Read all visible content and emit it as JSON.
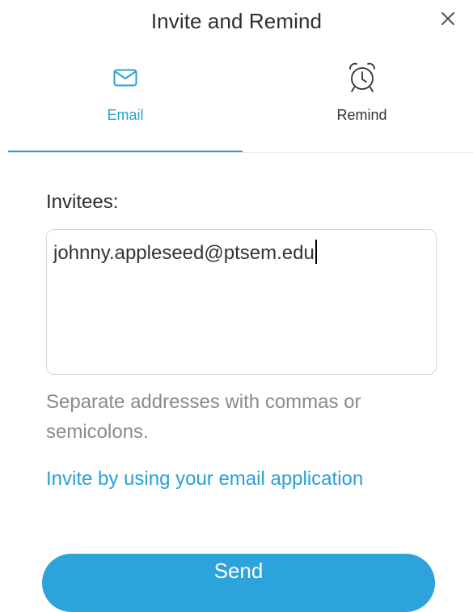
{
  "header": {
    "title": "Invite and Remind",
    "close_icon": "close-icon"
  },
  "tabs": [
    {
      "label": "Email",
      "icon": "envelope-icon",
      "active": true
    },
    {
      "label": "Remind",
      "icon": "alarm-clock-icon",
      "active": false
    }
  ],
  "form": {
    "invitees_label": "Invitees:",
    "invitees_value": "johnny.appleseed@ptsem.edu",
    "hint": "Separate addresses with commas or semicolons.",
    "invite_link": "Invite by using your email application",
    "send_label": "Send"
  },
  "colors": {
    "accent": "#2b9fd4",
    "button": "#2ca3da",
    "hint_text": "#8a8a8a"
  }
}
